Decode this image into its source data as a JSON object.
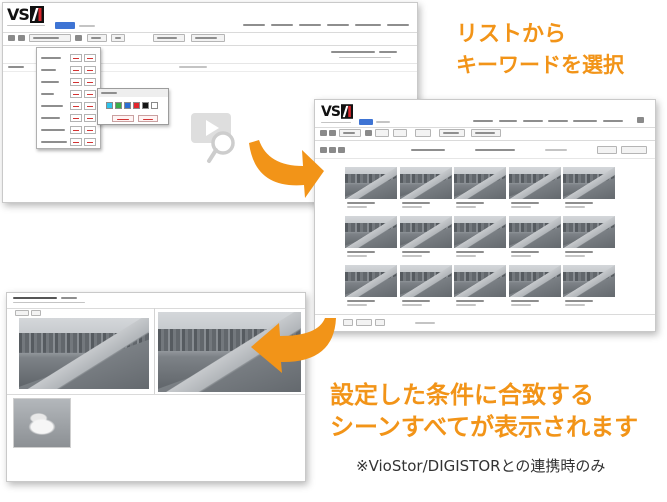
{
  "captions": {
    "select_keyword": [
      "リストから",
      "キーワードを選択"
    ],
    "matching_scenes": [
      "設定した条件に合致する",
      "シーンすべてが表示されます"
    ],
    "note": "※VioStor/DIGISTORとの連携時のみ"
  },
  "logo": {
    "text": "VS"
  },
  "colors": {
    "accent": "#F29418",
    "note_text": "#333333",
    "selected_tab": "#3e74d4",
    "logo_red": "#d8262c"
  },
  "keyword_popup": {
    "swatches": [
      "#2ec2ea",
      "#3aad49",
      "#2b6dd3",
      "#e2262c",
      "#151515",
      "#ffffff"
    ]
  },
  "icons": {
    "video_search": "video-search-icon",
    "arrows": "curved-arrow-icon",
    "logo_mark": "logo-mark-icon"
  }
}
